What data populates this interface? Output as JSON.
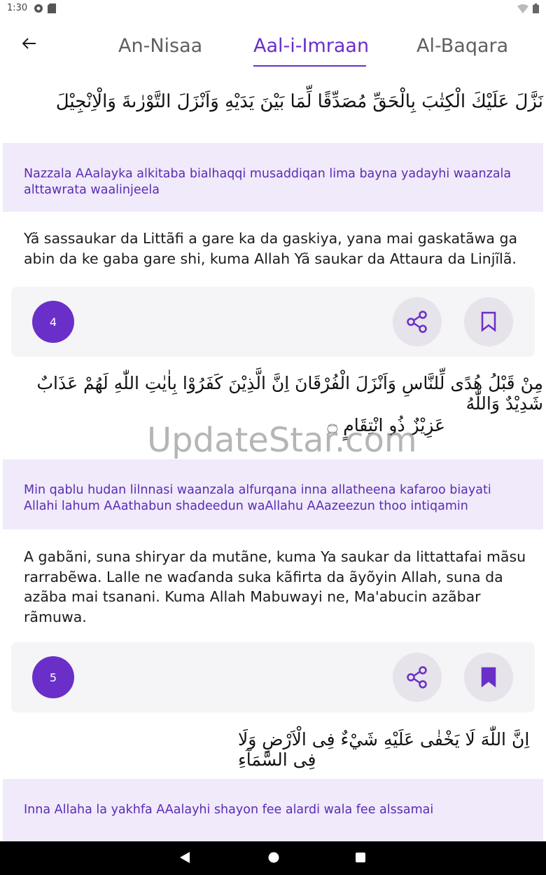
{
  "status_bar": {
    "time": "1:30"
  },
  "tabs": [
    {
      "label": "An-Nisaa",
      "active": false
    },
    {
      "label": "Aal-i-Imraan",
      "active": true
    },
    {
      "label": "Al-Baqara",
      "active": false
    }
  ],
  "verses": [
    {
      "arabic": "نَزَّلَ عَلَيْكَ الْكِتٰبَ بِالْحَقِّ مُصَدِّقًا لِّمَا بَيْنَ يَدَيْهِ وَاَنْزَلَ التَّوْرٰىةَ وَالْاِنْجِيْلَ",
      "transliteration": "Nazzala AAalayka alkitaba bialhaqqi musaddiqan lima bayna yadayhi waanzala alttawrata waalinjeela",
      "translation": "Yã sassaukar da Littãfi a gare ka da gaskiya, yana mai gaskatãwa ga abin da ke gaba gare shi, kuma Allah Yã saukar da Attaura da Linjĩlã."
    },
    {
      "number": "4",
      "arabic_line1": "مِنْ قَبْلُ هُدًى لِّلنَّاسِ وَاَنْزَلَ الْفُرْقَانَ اِنَّ الَّذِيْنَ كَفَرُوْا بِاٰيٰتِ اللّٰهِ لَهُمْ عَذَابٌ شَدِيْدٌ وَاللّٰهُ",
      "arabic_line2": "عَزِيْزٌ ذُو انْتِقَامٍ ۝",
      "transliteration": "Min qablu hudan lilnnasi waanzala alfurqana inna allatheena kafaroo biayati Allahi lahum AAathabun shadeedun waAllahu AAazeezun thoo intiqamin",
      "translation": "A gabãni, suna shiryar da mutãne, kuma Ya saukar da littattafai mãsu rarrabẽwa. Lalle ne waɗanda suka kãfirta da ãyõyin Allah, suna da azãba mai tsanani. Kuma Allah Mabuwayi ne, Ma'abucin azãbar rãmuwa."
    },
    {
      "number": "5",
      "arabic": "اِنَّ اللّٰهَ لَا يَخْفٰى عَلَيْهِ شَيْءٌ فِى الْاَرْضِ وَلَا فِى السَّمَآءِ",
      "transliteration": "Inna Allaha la yakhfa AAalayhi shayon fee alardi wala fee alssamai"
    }
  ],
  "watermark": "UpdateStar.com",
  "colors": {
    "accent": "#6a2fc9",
    "translit_bg": "#f0eafb",
    "translit_text": "#5b2bb5"
  }
}
